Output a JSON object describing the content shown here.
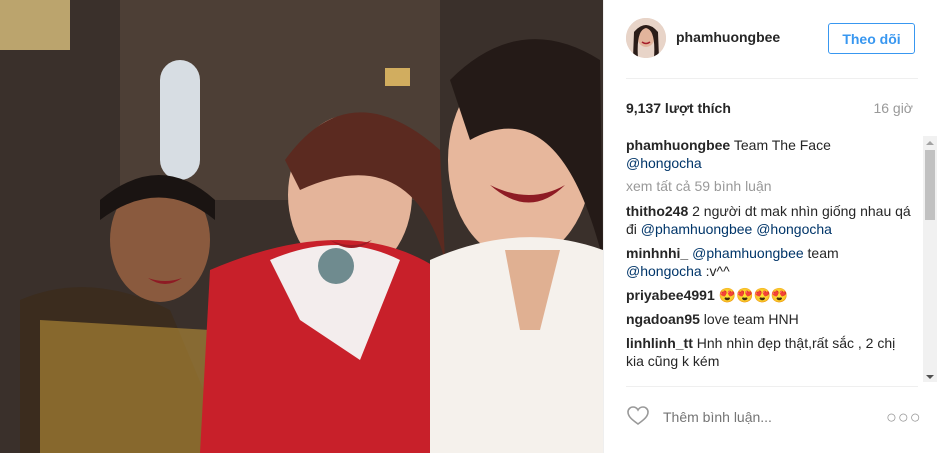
{
  "post": {
    "username": "phamhuongbee",
    "follow_label": "Theo dõi",
    "likes": "9,137 lượt thích",
    "time": "16 giờ"
  },
  "caption": {
    "username": "phamhuongbee",
    "text": "Team The Face",
    "mention": "@hongocha"
  },
  "view_all": "xem tất cả 59 bình luận",
  "comments": [
    {
      "username": "thitho248",
      "text": "2 người dt mak nhìn giống nhau qá đi",
      "mentions": "@phamhuongbee @hongocha"
    },
    {
      "username": "minhnhi_",
      "mention1": "@phamhuongbee",
      "text": "team",
      "mention2": "@hongocha",
      "suffix": ":v^^"
    },
    {
      "username": "priyabee4991",
      "text": "😍😍😍😍"
    },
    {
      "username": "ngadoan95",
      "text": "love team HNH"
    },
    {
      "username": "linhlinh_tt",
      "text": "Hnh nhìn đẹp thật,rất sắc , 2 chị kia cũng k kém"
    }
  ],
  "footer": {
    "add_comment_placeholder": "Thêm bình luận...",
    "more": "○○○"
  },
  "colors": {
    "accent": "#3897f0",
    "mention": "#003569",
    "muted": "#999999"
  }
}
